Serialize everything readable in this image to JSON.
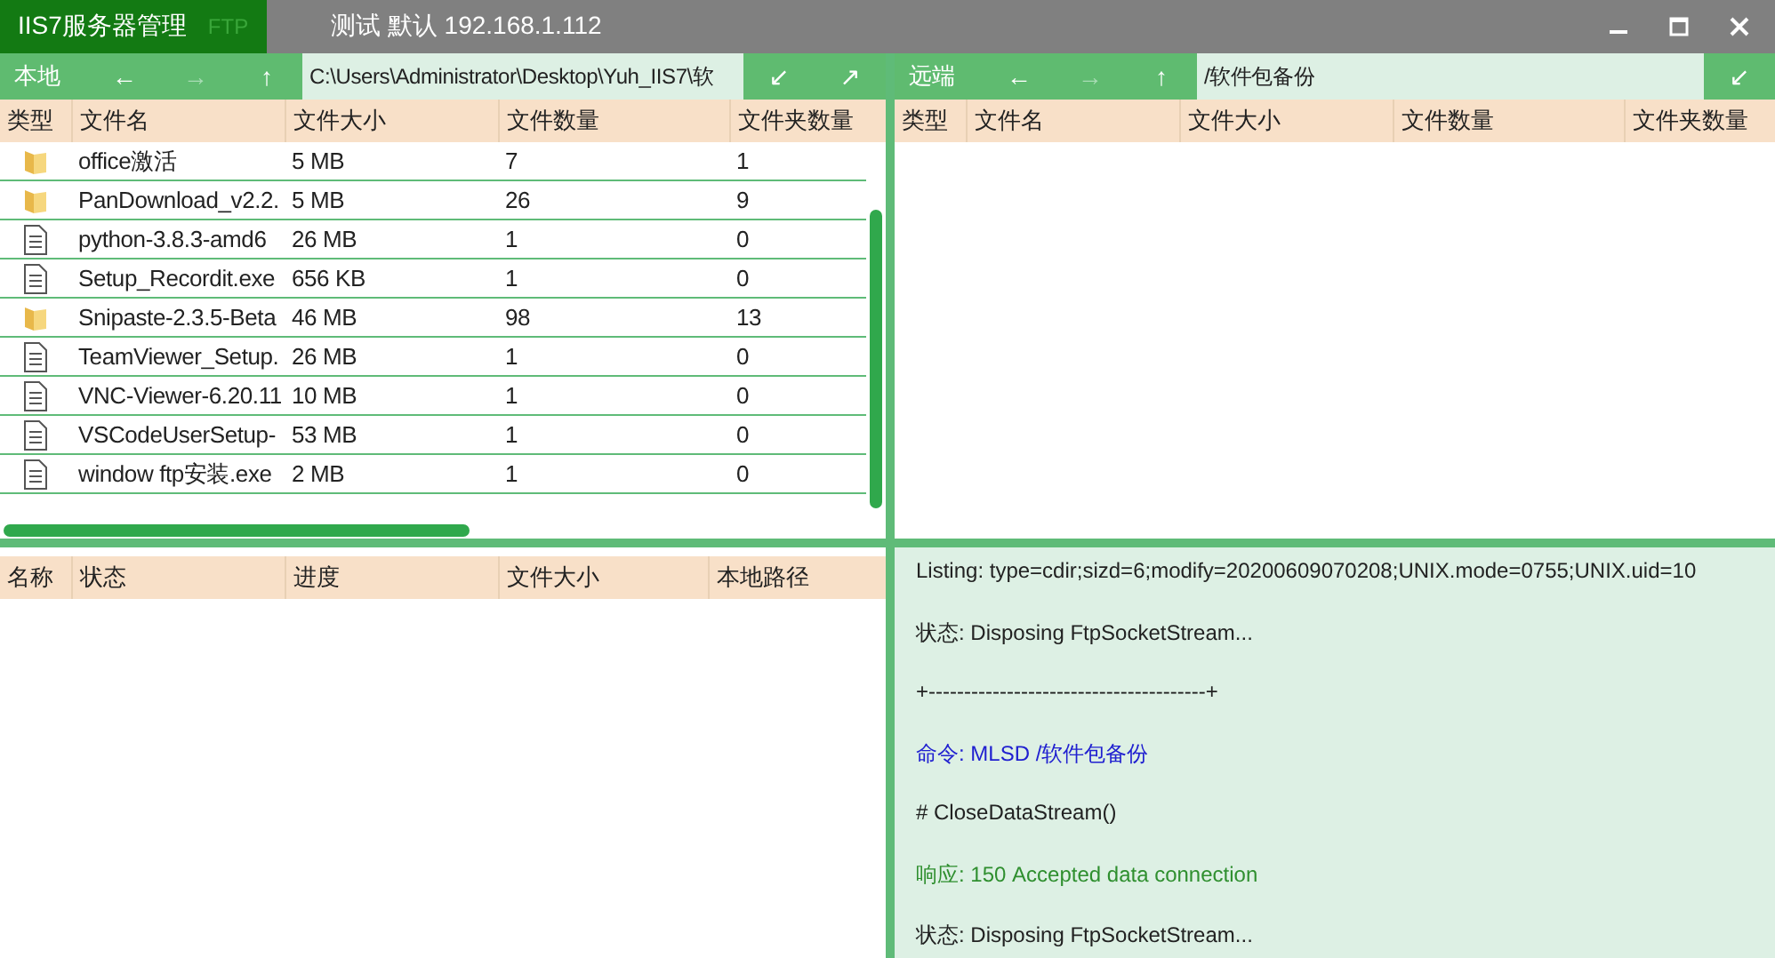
{
  "window": {
    "title": "IIS7服务器管理",
    "badge": "FTP",
    "connection": "测试  默认  192.168.1.112"
  },
  "local": {
    "label": "本地",
    "back": "←",
    "forward": "→",
    "up": "↑",
    "path": "C:\\Users\\Administrator\\Desktop\\Yuh_IIS7\\软",
    "download": "↙",
    "upload": "↗",
    "columns": [
      "类型",
      "文件名",
      "文件大小",
      "文件数量",
      "文件夹数量"
    ],
    "rows": [
      {
        "kind": "folder",
        "name": "office激活",
        "size": "5 MB",
        "files": "7",
        "folders": "1"
      },
      {
        "kind": "folder",
        "name": "PanDownload_v2.2.",
        "size": "5 MB",
        "files": "26",
        "folders": "9"
      },
      {
        "kind": "file",
        "name": "python-3.8.3-amd6",
        "size": "26 MB",
        "files": "1",
        "folders": "0"
      },
      {
        "kind": "file",
        "name": "Setup_Recordit.exe",
        "size": "656 KB",
        "files": "1",
        "folders": "0"
      },
      {
        "kind": "folder",
        "name": "Snipaste-2.3.5-Beta",
        "size": "46 MB",
        "files": "98",
        "folders": "13"
      },
      {
        "kind": "file",
        "name": "TeamViewer_Setup.",
        "size": "26 MB",
        "files": "1",
        "folders": "0"
      },
      {
        "kind": "file",
        "name": "VNC-Viewer-6.20.11",
        "size": "10 MB",
        "files": "1",
        "folders": "0"
      },
      {
        "kind": "file",
        "name": "VSCodeUserSetup-",
        "size": "53 MB",
        "files": "1",
        "folders": "0"
      },
      {
        "kind": "file",
        "name": "window ftp安装.exe",
        "size": "2 MB",
        "files": "1",
        "folders": "0"
      }
    ]
  },
  "remote": {
    "label": "远端",
    "back": "←",
    "forward": "→",
    "up": "↑",
    "path": "/软件包备份",
    "download": "↙",
    "columns": [
      "类型",
      "文件名",
      "文件大小",
      "文件数量",
      "文件夹数量"
    ]
  },
  "queue": {
    "columns": [
      "名称",
      "状态",
      "进度",
      "文件大小",
      "本地路径"
    ]
  },
  "log": [
    {
      "kind": "status",
      "text": "Listing:  type=cdir;sizd=6;modify=20200609070208;UNIX.mode=0755;UNIX.uid=10"
    },
    {
      "kind": "status",
      "text": "状态:   Disposing FtpSocketStream..."
    },
    {
      "kind": "status",
      "text": "+---------------------------------------+"
    },
    {
      "kind": "command",
      "text": "命令:  MLSD /软件包备份"
    },
    {
      "kind": "status",
      "text": "# CloseDataStream()"
    },
    {
      "kind": "response",
      "text": "响应: 150 Accepted data connection"
    },
    {
      "kind": "status",
      "text": "状态:   Disposing FtpSocketStream..."
    }
  ]
}
